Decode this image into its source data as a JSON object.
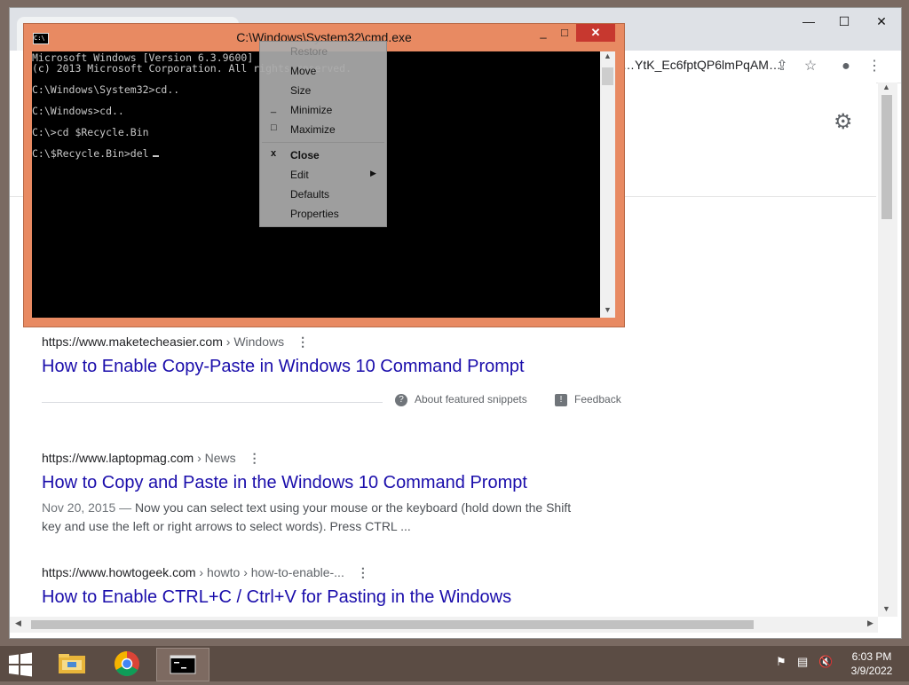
{
  "chrome": {
    "url": "…YtK_Ec6fptQP6lmPqAM…",
    "icons": {
      "share": "share-icon",
      "bookmark": "star-icon",
      "profile": "profile-icon",
      "menu": "kebab-icon",
      "settings": "gear-icon"
    },
    "window_controls": {
      "minimize": "—",
      "maximize": "☐",
      "close": "✕"
    }
  },
  "results": [
    {
      "url": "https://www.maketecheasier.com",
      "crumbs": " › Windows",
      "title": "How to Enable Copy-Paste in Windows 10 Command Prompt"
    },
    {
      "url": "https://www.laptopmag.com",
      "crumbs": " › News",
      "title": "How to Copy and Paste in the Windows 10 Command Prompt",
      "date": "Nov 20, 2015 —",
      "snippet": " Now you can select text using your mouse or the keyboard (hold down the Shift key and use the left or right arrows to select words). Press CTRL ..."
    },
    {
      "url": "https://www.howtogeek.com",
      "crumbs": " › howto › how-to-enable-...",
      "title": "How to Enable CTRL+C / Ctrl+V for Pasting in the Windows"
    }
  ],
  "featured_snippets": {
    "about": "About featured snippets",
    "feedback": "Feedback"
  },
  "cmd": {
    "title": "C:\\Windows\\System32\\cmd.exe",
    "lines": [
      "Microsoft Windows [Version 6.3.9600]",
      "(c) 2013 Microsoft Corporation. All rights reserved.",
      "",
      "C:\\Windows\\System32>cd..",
      "",
      "C:\\Windows>cd..",
      "",
      "C:\\>cd $Recycle.Bin",
      "",
      "C:\\$Recycle.Bin>del"
    ],
    "controls": {
      "minimize": "_",
      "maximize": "□",
      "close": "✕"
    }
  },
  "system_menu": {
    "items": [
      {
        "label": "Restore",
        "mark": "",
        "disabled": true
      },
      {
        "label": "Move",
        "mark": "",
        "disabled": false
      },
      {
        "label": "Size",
        "mark": "",
        "disabled": false
      },
      {
        "label": "Minimize",
        "mark": "_",
        "disabled": false
      },
      {
        "label": "Maximize",
        "mark": "□",
        "disabled": false
      },
      {
        "label": "Close",
        "mark": "x",
        "disabled": false,
        "bold": true
      },
      {
        "label": "Edit",
        "mark": "",
        "disabled": false,
        "submenu": true
      },
      {
        "label": "Defaults",
        "mark": "",
        "disabled": false
      },
      {
        "label": "Properties",
        "mark": "",
        "disabled": false
      }
    ]
  },
  "taskbar": {
    "apps": [
      "file-explorer-icon",
      "chrome-icon",
      "cmd-icon"
    ],
    "time": "6:03 PM",
    "date": "3/9/2022"
  }
}
